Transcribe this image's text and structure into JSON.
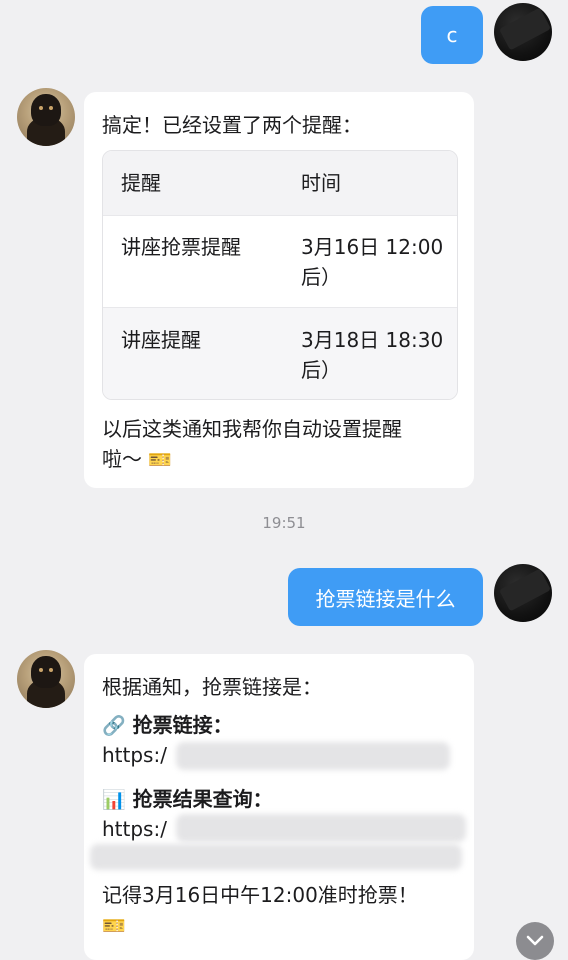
{
  "messages": {
    "m1": {
      "text": "c"
    },
    "m2": {
      "intro": "搞定！已经设置了两个提醒：",
      "table": {
        "headers": [
          "提醒",
          "时间"
        ],
        "rows": [
          {
            "name": "讲座抢票提醒",
            "time_line1": "3月16日 12:00（",
            "time_line2": "后）"
          },
          {
            "name": "讲座提醒",
            "time_line1": "3月18日 18:30（",
            "time_line2": "后）"
          }
        ]
      },
      "outro_line1": "以后这类通知我帮你自动设置提醒",
      "outro_line2": "啦～",
      "outro_emoji": "🎫"
    },
    "timestamp": "19:51",
    "m3": {
      "text": "抢票链接是什么"
    },
    "m4": {
      "intro": "根据通知，抢票链接是：",
      "link1_icon": "🔗",
      "link1_label": "抢票链接：",
      "link1_prefix": "https:/",
      "link2_icon": "📊",
      "link2_label": "抢票结果查询：",
      "link2_prefix": "https:/",
      "reminder": "记得3月16日中午12:00准时抢票！",
      "reminder_emoji": "🎫"
    }
  },
  "icons": {
    "scroll_down": "chevron-down-icon"
  },
  "colors": {
    "user_bubble": "#3f9cf5",
    "bot_bubble": "#ffffff",
    "background": "#f0f0f2"
  }
}
